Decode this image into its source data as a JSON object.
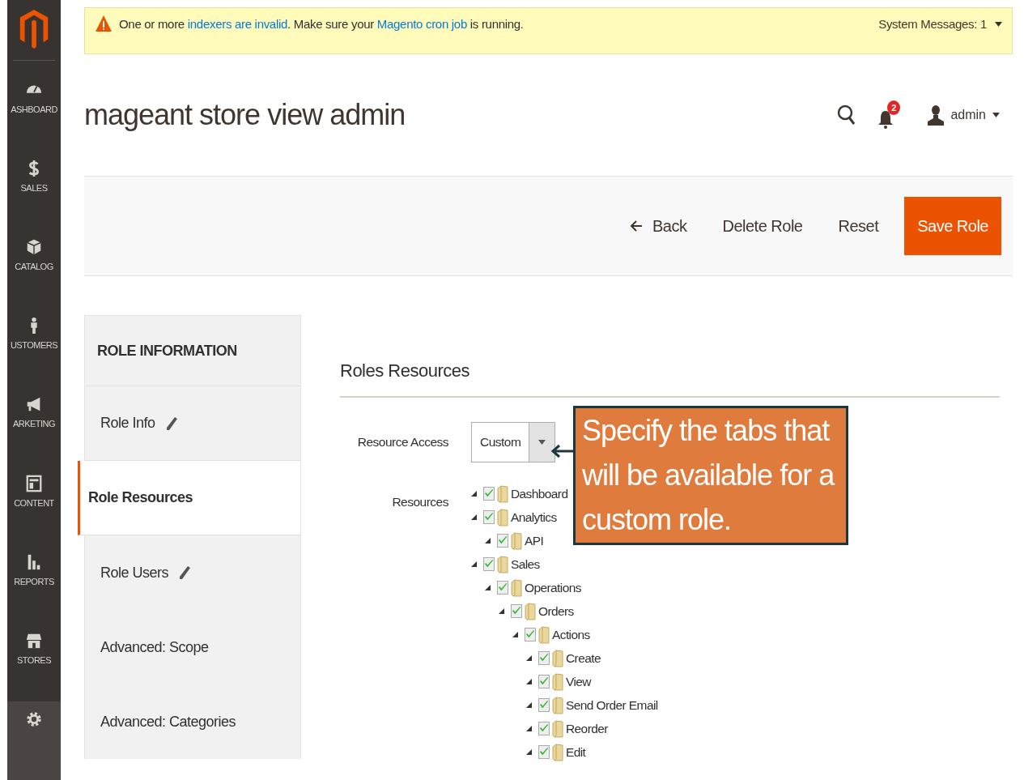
{
  "sidebar": {
    "items": [
      {
        "kind": "dashboard",
        "label": "ASHBOARD",
        "selected": false
      },
      {
        "kind": "sales",
        "label": "SALES",
        "selected": false
      },
      {
        "kind": "catalog",
        "label": "CATALOG",
        "selected": false
      },
      {
        "kind": "customers",
        "label": "USTOMERS",
        "selected": false
      },
      {
        "kind": "marketing",
        "label": "ARKETING",
        "selected": false
      },
      {
        "kind": "content",
        "label": "CONTENT",
        "selected": false
      },
      {
        "kind": "reports",
        "label": "REPORTS",
        "selected": false
      },
      {
        "kind": "stores",
        "label": "STORES",
        "selected": false
      },
      {
        "kind": "system",
        "selected": true
      }
    ]
  },
  "message": {
    "parts": [
      {
        "kind": "text",
        "text": "One or more "
      },
      {
        "kind": "link",
        "text": "indexers are invalid"
      },
      {
        "kind": "text",
        "text": ". Make sure your "
      },
      {
        "kind": "link",
        "text": "Magento cron job"
      },
      {
        "kind": "text",
        "text": " is running."
      }
    ],
    "system_messages": "System Messages: 1"
  },
  "header": {
    "title": "mageant store view admin",
    "notifications": "2",
    "user": "admin"
  },
  "actions": [
    {
      "kind": "back",
      "label": "Back"
    },
    {
      "kind": "plain",
      "label": "Delete Role"
    },
    {
      "kind": "plain",
      "label": "Reset"
    },
    {
      "kind": "primary",
      "label": "Save Role"
    }
  ],
  "tabs": {
    "title": "ROLE INFORMATION",
    "items": [
      {
        "label": "Role Info",
        "edited": true,
        "selected": false
      },
      {
        "label": "Role Resources",
        "edited": false,
        "selected": true
      },
      {
        "label": "Role Users",
        "edited": true,
        "selected": false
      },
      {
        "label": "Advanced: Scope",
        "edited": false,
        "selected": false
      },
      {
        "label": "Advanced: Categories",
        "edited": false,
        "selected": false
      }
    ]
  },
  "section_title": "Roles Resources",
  "resource_access": {
    "label": "Resource Access",
    "value": "Custom"
  },
  "resources_label": "Resources",
  "callout": "Specify the tabs that will be available for a custom role.",
  "tree": [
    {
      "label": "Dashboard",
      "expanded": true,
      "checked": true
    },
    {
      "label": "Analytics",
      "expanded": true,
      "checked": true,
      "children": [
        {
          "label": "API",
          "expanded": true,
          "checked": true
        }
      ]
    },
    {
      "label": "Sales",
      "expanded": true,
      "checked": true,
      "children": [
        {
          "label": "Operations",
          "expanded": true,
          "checked": true,
          "children": [
            {
              "label": "Orders",
              "expanded": true,
              "checked": true,
              "children": [
                {
                  "label": "Actions",
                  "expanded": true,
                  "checked": true,
                  "children": [
                    {
                      "label": "Create",
                      "expanded": true,
                      "checked": true
                    },
                    {
                      "label": "View",
                      "expanded": true,
                      "checked": true
                    },
                    {
                      "label": "Send Order Email",
                      "expanded": true,
                      "checked": true
                    },
                    {
                      "label": "Reorder",
                      "expanded": true,
                      "checked": true
                    },
                    {
                      "label": "Edit",
                      "expanded": true,
                      "checked": true
                    }
                  ]
                }
              ]
            }
          ]
        }
      ]
    }
  ]
}
